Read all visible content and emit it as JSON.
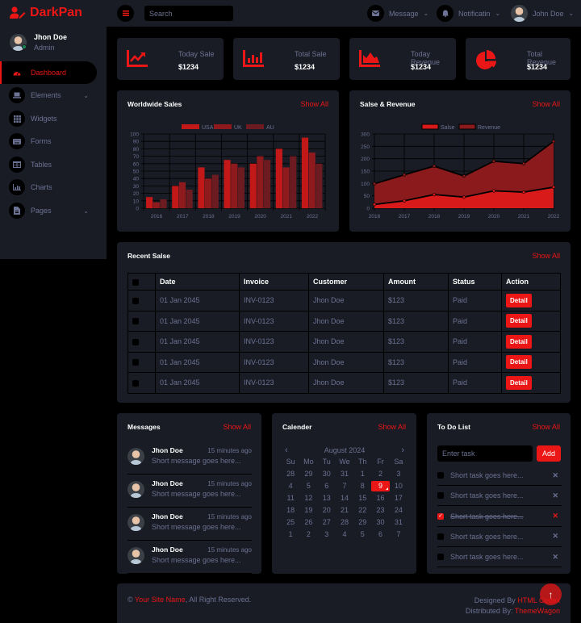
{
  "brand": {
    "name": "DarkPan",
    "icon": "user-edit-icon"
  },
  "topbar": {
    "search_placeholder": "Search",
    "message_label": "Message",
    "notification_label": "Notificatin",
    "user_name": "John Doe"
  },
  "sidebar": {
    "profile": {
      "name": "Jhon Doe",
      "role": "Admin"
    },
    "items": [
      {
        "label": "Dashboard",
        "icon": "tachometer-icon",
        "active": true
      },
      {
        "label": "Elements",
        "icon": "laptop-icon",
        "dropdown": true
      },
      {
        "label": "Widgets",
        "icon": "th-icon"
      },
      {
        "label": "Forms",
        "icon": "keyboard-icon"
      },
      {
        "label": "Tables",
        "icon": "table-icon"
      },
      {
        "label": "Charts",
        "icon": "chart-bar-icon"
      },
      {
        "label": "Pages",
        "icon": "file-icon",
        "dropdown": true
      }
    ]
  },
  "stats": [
    {
      "label": "Today Sale",
      "value": "$1234",
      "icon": "chart-line-icon"
    },
    {
      "label": "Total Sale",
      "value": "$1234",
      "icon": "chart-bar-icon"
    },
    {
      "label": "Today Revenue",
      "value": "$1234",
      "icon": "chart-area-icon"
    },
    {
      "label": "Total Revenue",
      "value": "$1234",
      "icon": "chart-pie-icon"
    }
  ],
  "colors": {
    "accent": "#EB1616",
    "panel": "#191C24",
    "bg": "#000000",
    "muted": "#6C7293"
  },
  "chart_data": [
    {
      "type": "bar",
      "title": "Worldwide Sales",
      "show_all": "Show All",
      "categories": [
        "2016",
        "2017",
        "2018",
        "2019",
        "2020",
        "2021",
        "2022"
      ],
      "series": [
        {
          "name": "USA",
          "color": "#C21818",
          "values": [
            15,
            30,
            55,
            65,
            60,
            80,
            95
          ]
        },
        {
          "name": "UK",
          "color": "#8E1A1E",
          "values": [
            8,
            35,
            40,
            60,
            70,
            55,
            75
          ]
        },
        {
          "name": "AU",
          "color": "#6C1B20",
          "values": [
            12,
            25,
            45,
            55,
            65,
            70,
            60
          ]
        }
      ],
      "ylim": [
        0,
        100
      ],
      "yticks": [
        0,
        10,
        20,
        30,
        40,
        50,
        60,
        70,
        80,
        90,
        100
      ],
      "legend": "top",
      "grid": true
    },
    {
      "type": "area",
      "title": "Salse & Revenue",
      "show_all": "Show All",
      "categories": [
        "2016",
        "2017",
        "2018",
        "2019",
        "2020",
        "2021",
        "2022"
      ],
      "series": [
        {
          "name": "Salse",
          "color": "#D81A1A",
          "values": [
            15,
            30,
            55,
            45,
            70,
            65,
            85
          ]
        },
        {
          "name": "Revenue",
          "color": "#8A1A1C",
          "values": [
            99,
            135,
            170,
            130,
            190,
            180,
            270
          ]
        }
      ],
      "ylim": [
        0,
        300
      ],
      "yticks": [
        0,
        50,
        100,
        150,
        200,
        250,
        300
      ],
      "legend": "top",
      "grid": true
    }
  ],
  "recent_sales": {
    "title": "Recent Salse",
    "show_all": "Show All",
    "columns": [
      "",
      "Date",
      "Invoice",
      "Customer",
      "Amount",
      "Status",
      "Action"
    ],
    "rows": [
      {
        "date": "01 Jan 2045",
        "invoice": "INV-0123",
        "customer": "Jhon Doe",
        "amount": "$123",
        "status": "Paid",
        "action": "Detail"
      },
      {
        "date": "01 Jan 2045",
        "invoice": "INV-0123",
        "customer": "Jhon Doe",
        "amount": "$123",
        "status": "Paid",
        "action": "Detail"
      },
      {
        "date": "01 Jan 2045",
        "invoice": "INV-0123",
        "customer": "Jhon Doe",
        "amount": "$123",
        "status": "Paid",
        "action": "Detail"
      },
      {
        "date": "01 Jan 2045",
        "invoice": "INV-0123",
        "customer": "Jhon Doe",
        "amount": "$123",
        "status": "Paid",
        "action": "Detail"
      },
      {
        "date": "01 Jan 2045",
        "invoice": "INV-0123",
        "customer": "Jhon Doe",
        "amount": "$123",
        "status": "Paid",
        "action": "Detail"
      }
    ]
  },
  "messages": {
    "title": "Messages",
    "show_all": "Show All",
    "items": [
      {
        "name": "Jhon Doe",
        "time": "15 minutes ago",
        "text": "Short message goes here..."
      },
      {
        "name": "Jhon Doe",
        "time": "15 minutes ago",
        "text": "Short message goes here..."
      },
      {
        "name": "Jhon Doe",
        "time": "15 minutes ago",
        "text": "Short message goes here..."
      },
      {
        "name": "Jhon Doe",
        "time": "15 minutes ago",
        "text": "Short message goes here..."
      }
    ]
  },
  "calendar": {
    "title": "Calender",
    "show_all": "Show All",
    "month": "August 2024",
    "weekdays": [
      "Su",
      "Mo",
      "Tu",
      "We",
      "Th",
      "Fr",
      "Sa"
    ],
    "days": [
      "28",
      "29",
      "30",
      "31",
      "1",
      "2",
      "3",
      "4",
      "5",
      "6",
      "7",
      "8",
      "9",
      "10",
      "11",
      "12",
      "13",
      "14",
      "15",
      "16",
      "17",
      "18",
      "19",
      "20",
      "21",
      "22",
      "23",
      "24",
      "25",
      "26",
      "27",
      "28",
      "29",
      "30",
      "31",
      "1",
      "2",
      "3",
      "4",
      "5",
      "6",
      "7"
    ],
    "selected": "9"
  },
  "todo": {
    "title": "To Do List",
    "show_all": "Show All",
    "input_placeholder": "Enter task",
    "add_label": "Add",
    "items": [
      {
        "text": "Short task goes here...",
        "done": false
      },
      {
        "text": "Short task goes here...",
        "done": false
      },
      {
        "text": "Short task goes here...",
        "done": true
      },
      {
        "text": "Short task goes here...",
        "done": false
      },
      {
        "text": "Short task goes here...",
        "done": false
      }
    ]
  },
  "footer": {
    "copyright_symbol": "©",
    "site_name": "Your Site Name",
    "rights": ", All Right Reserved.",
    "designed_by_label": "Designed By ",
    "designed_by": "HTML Codex",
    "distributed_by_label": "Distributed By: ",
    "distributed_by": "ThemeWagon"
  }
}
